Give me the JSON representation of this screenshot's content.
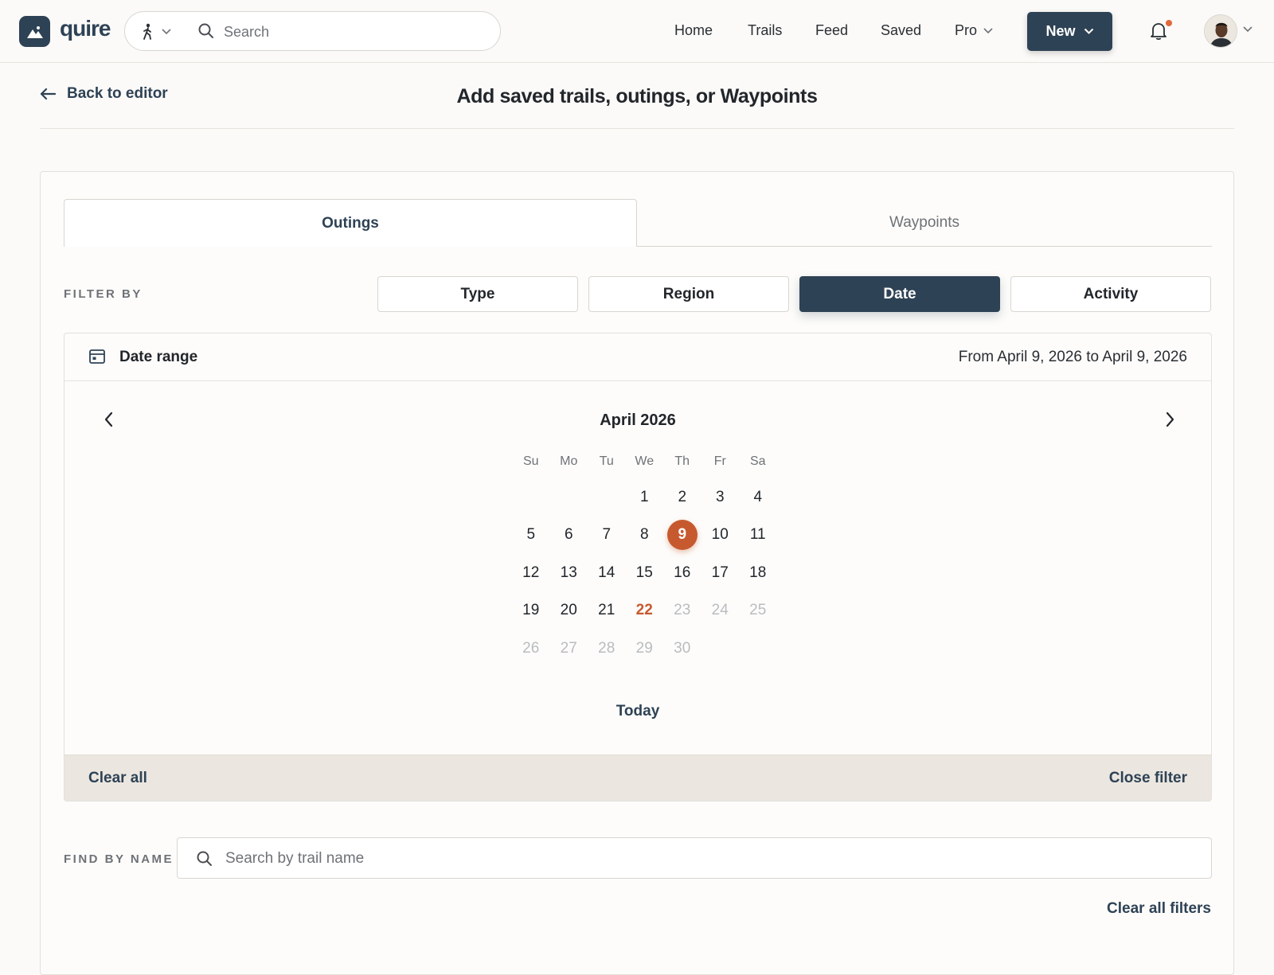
{
  "app": {
    "brand": "quire"
  },
  "topnav": {
    "search_placeholder": "Search",
    "links": {
      "home": "Home",
      "trails": "Trails",
      "feed": "Feed",
      "saved": "Saved",
      "pro": "Pro"
    },
    "new_label": "New",
    "notification_dot_color": "#e06a3b"
  },
  "header": {
    "back_label": "Back to editor",
    "title": "Add saved trails, outings, or Waypoints"
  },
  "tabs": {
    "outings": "Outings",
    "waypoints": "Waypoints",
    "active": "Outings"
  },
  "filters": {
    "label": "FILTER BY",
    "type": "Type",
    "region": "Region",
    "date": "Date",
    "activity": "Activity",
    "active": "Date"
  },
  "date_panel": {
    "title": "Date range",
    "range_text": "From April 9, 2026 to April 9, 2026",
    "month_title": "April 2026",
    "weekdays": [
      "Su",
      "Mo",
      "Tu",
      "We",
      "Th",
      "Fr",
      "Sa"
    ],
    "weeks": [
      [
        "",
        "",
        "",
        "1",
        "2",
        "3",
        "4"
      ],
      [
        "5",
        "6",
        "7",
        "8",
        "9",
        "10",
        "11"
      ],
      [
        "12",
        "13",
        "14",
        "15",
        "16",
        "17",
        "18"
      ],
      [
        "19",
        "20",
        "21",
        "22",
        "23",
        "24",
        "25"
      ],
      [
        "26",
        "27",
        "28",
        "29",
        "30",
        "",
        ""
      ]
    ],
    "selected_day": "9",
    "highlight_day": "22",
    "disabled_from": 23,
    "today_label": "Today",
    "clear_label": "Clear all",
    "close_label": "Close filter"
  },
  "find_by_name": {
    "label": "FIND BY NAME",
    "placeholder": "Search by trail name"
  },
  "clear_all_filters": "Clear all filters",
  "colors": {
    "primary": "#2e4255",
    "accent": "#c65a2e",
    "muted": "#b9bcc0"
  }
}
